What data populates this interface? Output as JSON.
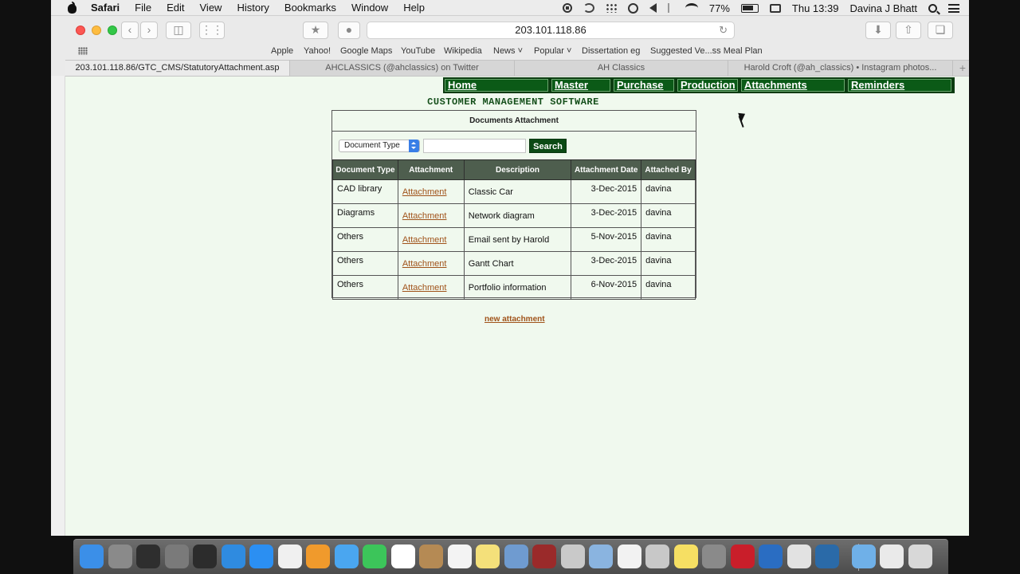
{
  "menubar": {
    "app_name": "Safari",
    "items": [
      "File",
      "Edit",
      "View",
      "History",
      "Bookmarks",
      "Window",
      "Help"
    ],
    "battery": "77%",
    "time": "Thu 13:39",
    "user": "Davina J Bhatt"
  },
  "browser": {
    "url": "203.101.118.86",
    "bookmarks": [
      "Apple",
      "Yahoo!",
      "Google Maps",
      "YouTube",
      "Wikipedia",
      "News",
      "Popular",
      "Dissertation eg",
      "Suggested Ve...ss Meal Plan"
    ],
    "tabs": [
      "203.101.118.86/GTC_CMS/StatutoryAttachment.asp",
      "AHCLASSICS (@ahclassics) on Twitter",
      "AH Classics",
      "Harold Croft (@ah_classics) • Instagram photos..."
    ]
  },
  "nav": [
    "Home",
    "Master",
    "Purchase",
    "Production",
    "Attachments",
    "Reminders"
  ],
  "page": {
    "title": "CUSTOMER MANAGEMENT SOFTWARE",
    "panel_title": "Documents Attachment",
    "select_value": "Document Type",
    "search_label": "Search",
    "columns": [
      "Document Type",
      "Attachment",
      "Description",
      "Attachment Date",
      "Attached By"
    ],
    "rows": [
      {
        "type": "CAD library",
        "attachment": "Attachment",
        "description": "Classic Car",
        "date": "3-Dec-2015",
        "by": "davina"
      },
      {
        "type": "Diagrams",
        "attachment": "Attachment",
        "description": "Network diagram",
        "date": "3-Dec-2015",
        "by": "davina"
      },
      {
        "type": "Others",
        "attachment": "Attachment",
        "description": "Email sent by Harold",
        "date": "5-Nov-2015",
        "by": "davina"
      },
      {
        "type": "Others",
        "attachment": "Attachment",
        "description": "Gantt Chart",
        "date": "3-Dec-2015",
        "by": "davina"
      },
      {
        "type": "Others",
        "attachment": "Attachment",
        "description": "Portfolio information",
        "date": "6-Nov-2015",
        "by": "davina"
      }
    ],
    "new_attachment": "new attachment"
  },
  "dock": {
    "apps": [
      "finder",
      "launchpad",
      "photo-booth",
      "system-preferences",
      "dashboard",
      "safari",
      "app-store",
      "itunes",
      "ibooks",
      "messages",
      "facetime",
      "calendar",
      "contacts",
      "reminders",
      "notes",
      "preview",
      "photo-booth-2",
      "image-capture",
      "preview-2",
      "photos",
      "mail",
      "stickies",
      "calculator",
      "cleaner",
      "word",
      "chrome",
      "quicktime",
      "downloads",
      "documents",
      "trash"
    ],
    "colors": [
      "#3b8fe8",
      "#8a8a8a",
      "#2e2e2e",
      "#7a7a7a",
      "#2c2c2c",
      "#2f8be0",
      "#2b8ff2",
      "#f0f0f0",
      "#f09a2c",
      "#4aa6f0",
      "#3cc55a",
      "#ffffff",
      "#b58a54",
      "#f3f3f3",
      "#f4e07a",
      "#6f9bd0",
      "#9a2a2a",
      "#c9c9c9",
      "#8ab4e0",
      "#f2f2f2",
      "#c8c8c8",
      "#f6df63",
      "#8a8a8a",
      "#c91e2a",
      "#2a6dc2",
      "#e2e2e2",
      "#2a6aa8",
      "#6fb0e8",
      "#eaeaea",
      "#d8d8d8"
    ]
  }
}
